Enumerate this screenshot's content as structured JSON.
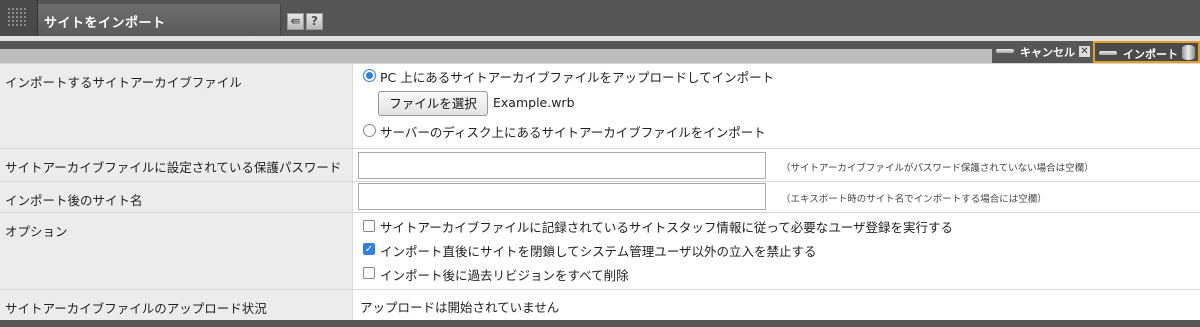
{
  "window": {
    "title": "サイトをインポート",
    "back_icon": "back-arrow-icon",
    "help_label": "?"
  },
  "actions": {
    "cancel_label": "キャンセル",
    "cancel_icon": "close-icon",
    "import_label": "インポート",
    "import_icon": "database-icon",
    "accent_color": "#e0a020"
  },
  "form": {
    "archive": {
      "label": "インポートするサイトアーカイブファイル",
      "option_upload": "PC 上にあるサイトアーカイブファイルをアップロードしてインポート",
      "file_button": "ファイルを選択",
      "file_name": "Example.wrb",
      "option_server": "サーバーのディスク上にあるサイトアーカイブファイルをインポート",
      "selected": "upload"
    },
    "password": {
      "label": "サイトアーカイブファイルに設定されている保護パスワード",
      "value": "",
      "note": "（サイトアーカイブファイルがパスワード保護されていない場合は空欄）"
    },
    "site_name": {
      "label": "インポート後のサイト名",
      "value": "",
      "note": "（エキスポート時のサイト名でインポートする場合には空欄）"
    },
    "options": {
      "label": "オプション",
      "items": [
        {
          "label": "サイトアーカイブファイルに記録されているサイトスタッフ情報に従って必要なユーザ登録を実行する",
          "checked": false
        },
        {
          "label": "インポート直後にサイトを閉鎖してシステム管理ユーザ以外の立入を禁止する",
          "checked": true
        },
        {
          "label": "インポート後に過去リビジョンをすべて削除",
          "checked": false
        }
      ]
    },
    "upload_status": {
      "label": "サイトアーカイブファイルのアップロード状況",
      "value": "アップロードは開始されていません"
    }
  }
}
